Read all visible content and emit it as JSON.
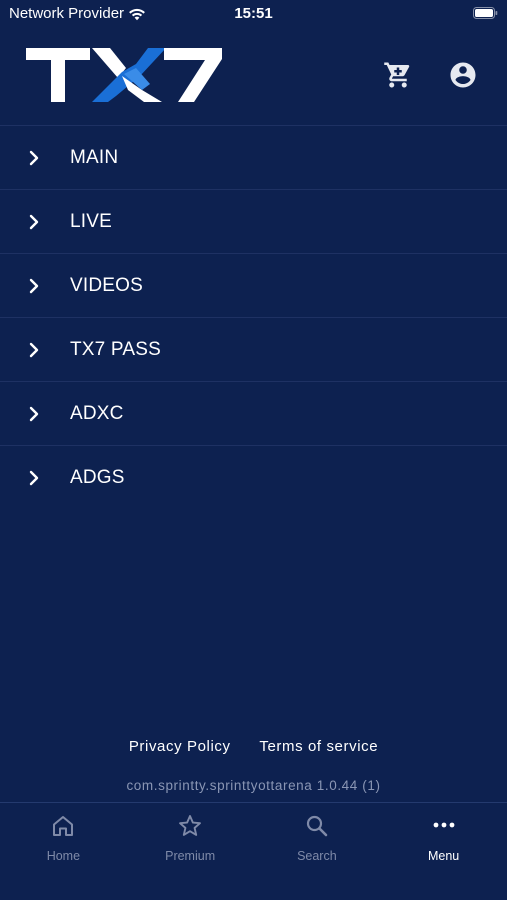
{
  "status_bar": {
    "carrier": "Network Provider",
    "time": "15:51",
    "icons": [
      "wifi-icon",
      "battery-icon"
    ]
  },
  "header": {
    "logo_text": "TX7",
    "icons": [
      "cart-icon",
      "account-circle-icon"
    ]
  },
  "menu": {
    "items": [
      {
        "label": "MAIN",
        "icon": "chevron-right-icon"
      },
      {
        "label": "LIVE",
        "icon": "chevron-right-icon"
      },
      {
        "label": "VIDEOS",
        "icon": "chevron-right-icon"
      },
      {
        "label": "TX7 PASS",
        "icon": "chevron-right-icon"
      },
      {
        "label": "ADXC",
        "icon": "chevron-right-icon"
      },
      {
        "label": "ADGS",
        "icon": "chevron-right-icon"
      }
    ]
  },
  "footer": {
    "privacy_label": "Privacy Policy",
    "terms_label": "Terms of service",
    "version": "com.sprintty.sprinttyottarena 1.0.44 (1)"
  },
  "tab_bar": {
    "tabs": [
      {
        "label": "Home",
        "icon": "home-icon",
        "active": false
      },
      {
        "label": "Premium",
        "icon": "star-icon",
        "active": false
      },
      {
        "label": "Search",
        "icon": "search-icon",
        "active": false
      },
      {
        "label": "Menu",
        "icon": "more-horizontal-icon",
        "active": true
      }
    ]
  },
  "colors": {
    "background": "#0d2150",
    "divider": "#1e3163",
    "text": "#ffffff",
    "inactive_tab": "#7f8aa8",
    "logo_accent": "#1a6fd6"
  }
}
